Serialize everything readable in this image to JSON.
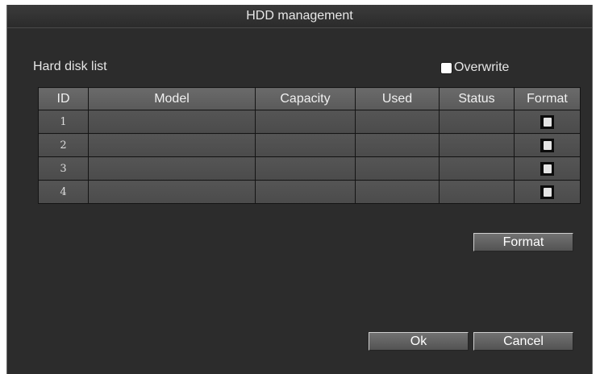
{
  "window": {
    "title": "HDD management"
  },
  "disk_list": {
    "label": "Hard disk list",
    "overwrite_label": "Overwrite",
    "overwrite_checked": false,
    "columns": [
      "ID",
      "Model",
      "Capacity",
      "Used",
      "Status",
      "Format"
    ],
    "rows": [
      {
        "id": "1",
        "model": "",
        "capacity": "",
        "used": "",
        "status": ""
      },
      {
        "id": "2",
        "model": "",
        "capacity": "",
        "used": "",
        "status": ""
      },
      {
        "id": "3",
        "model": "",
        "capacity": "",
        "used": "",
        "status": ""
      },
      {
        "id": "4",
        "model": "",
        "capacity": "",
        "used": "",
        "status": ""
      }
    ]
  },
  "buttons": {
    "format": "Format",
    "ok": "Ok",
    "cancel": "Cancel"
  },
  "colors": {
    "background": "#2c2c2c",
    "header_cell": "#626262",
    "body_cell": "#505050",
    "text": "#e6e6e6"
  }
}
